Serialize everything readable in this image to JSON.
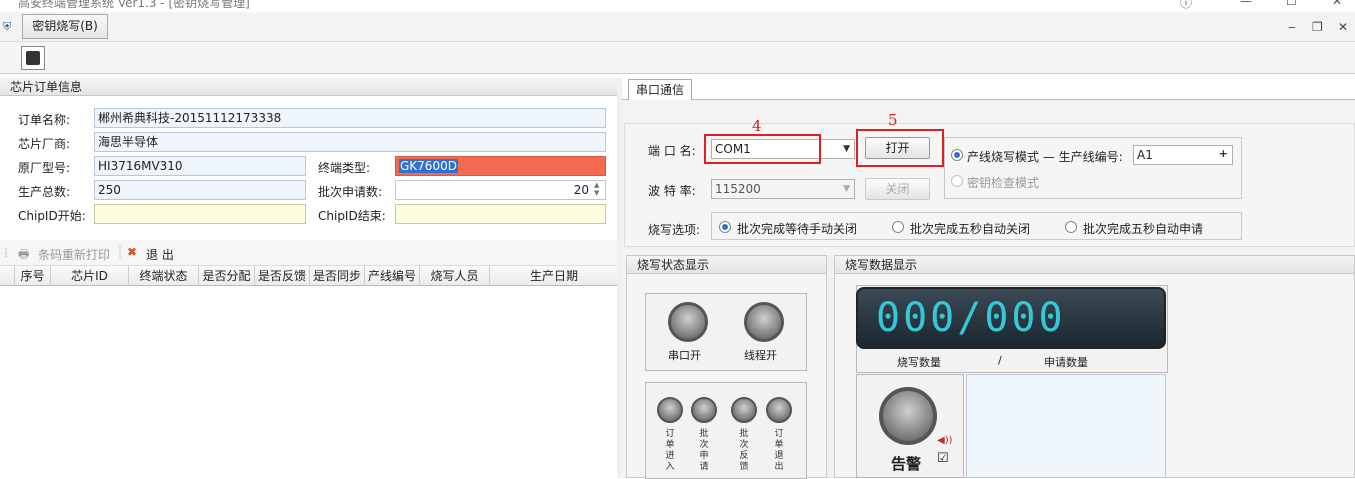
{
  "window": {
    "title": "高安终端管理系统 Ver1.3 - [密钥烧写管理]"
  },
  "menu": {
    "tab_label": "密钥烧写(B)"
  },
  "order_info": {
    "header": "芯片订单信息",
    "fields": {
      "order_name_label": "订单名称:",
      "order_name_value": "郴州希典科技-20151112173338",
      "vendor_label": "芯片厂商:",
      "vendor_value": "海思半导体",
      "model_label": "原厂型号:",
      "model_value": "HI3716MV310",
      "terminal_type_label": "终端类型:",
      "terminal_type_value": "GK7600D",
      "total_label": "生产总数:",
      "total_value": "250",
      "batch_label": "批次申请数:",
      "batch_value": "20",
      "chip_start_label": "ChipID开始:",
      "chip_end_label": "ChipID结束:"
    },
    "toolbar": {
      "reprint_label": "条码重新打印",
      "exit_label": "退 出"
    },
    "grid_columns": [
      "序号",
      "芯片ID",
      "终端状态",
      "是否分配",
      "是否反馈",
      "是否同步",
      "产线编号",
      "烧写人员",
      "生产日期"
    ]
  },
  "serial": {
    "tab_label": "串口通信",
    "port_label": "端 口 名:",
    "port_value": "COM1",
    "baud_label": "波 特 率:",
    "baud_value": "115200",
    "open_label": "打开",
    "close_label": "关闭",
    "annotation_4": "4",
    "annotation_5": "5",
    "mode_line_label": "产线烧写模式 — 生产线编号:",
    "line_number_value": "A1",
    "mode_check_label": "密钥检查模式",
    "burn_options_label": "烧写选项:",
    "options": [
      "批次完成等待手动关闭",
      "批次完成五秒自动关闭",
      "批次完成五秒自动申请"
    ]
  },
  "status_panel": {
    "header": "烧写状态显示",
    "serial_open": "串口开",
    "thread_open": "线程开",
    "indicators": [
      "订单进入",
      "批次申请",
      "批次反馈",
      "订单退出"
    ]
  },
  "data_panel": {
    "header": "烧写数据显示",
    "lcd_value": "000/000",
    "burn_count_label": "烧写数量",
    "slash": "/",
    "apply_count_label": "申请数量",
    "alarm_label": "告警"
  }
}
